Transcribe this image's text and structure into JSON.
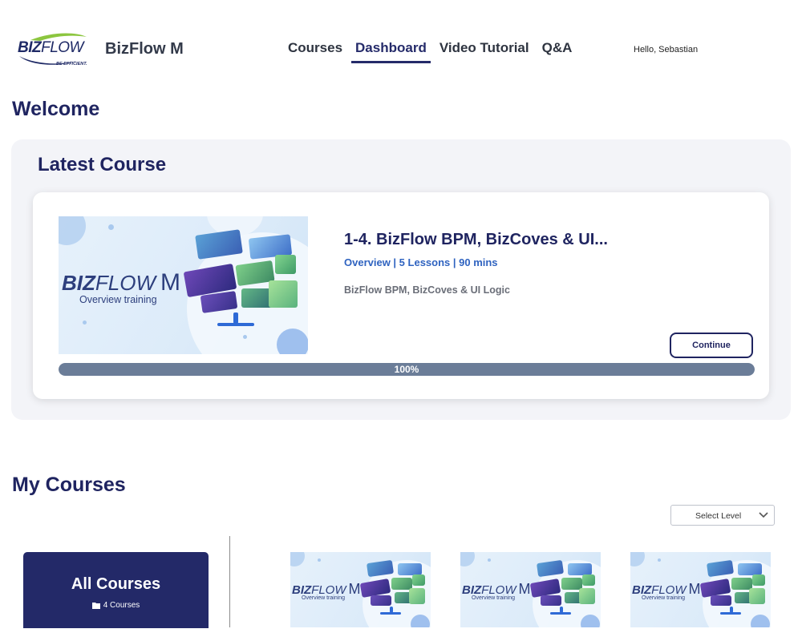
{
  "header": {
    "logo_text_biz": "BIZ",
    "logo_text_flow": "FLOW",
    "logo_tagline": "BE EFFICIENT.",
    "app_name": "BizFlow M",
    "nav": [
      {
        "label": "Courses",
        "active": false
      },
      {
        "label": "Dashboard",
        "active": true
      },
      {
        "label": "Video Tutorial",
        "active": false
      },
      {
        "label": "Q&A",
        "active": false
      }
    ],
    "greeting": "Hello, Sebastian"
  },
  "welcome": "Welcome",
  "latest": {
    "section_title": "Latest Course",
    "thumbnail": {
      "brand_biz": "BIZ",
      "brand_flow": "FLOW",
      "brand_m": "M",
      "subtitle": "Overview training"
    },
    "course_name": "1-4. BizFlow BPM, BizCoves & UI...",
    "meta": "Overview | 5 Lessons | 90 mins",
    "description": "BizFlow BPM, BizCoves & UI Logic",
    "continue_label": "Continue",
    "progress_value": 100,
    "progress_label": "100%"
  },
  "my_courses": {
    "title": "My Courses",
    "select_level": "Select Level",
    "all_courses_title": "All Courses",
    "all_courses_count": "4 Courses",
    "thumbnails": [
      {
        "brand_biz": "BIZ",
        "brand_flow": "FLOW",
        "brand_m": "M",
        "subtitle": "Overview training"
      },
      {
        "brand_biz": "BIZ",
        "brand_flow": "FLOW",
        "brand_m": "M",
        "subtitle": "Overview training"
      },
      {
        "brand_biz": "BIZ",
        "brand_flow": "FLOW",
        "brand_m": "M",
        "subtitle": "Overview training"
      }
    ]
  },
  "colors": {
    "primary_navy": "#232968",
    "accent_blue": "#2f63c0",
    "progress_fill": "#6b7d98",
    "panel_bg": "#f3f4f8"
  }
}
